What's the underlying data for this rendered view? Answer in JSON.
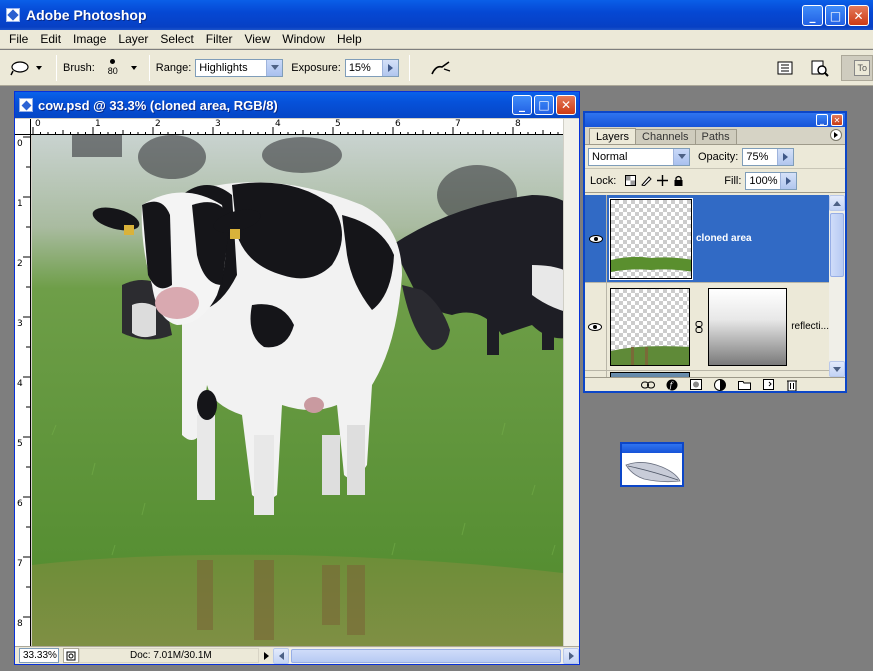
{
  "app": {
    "title": "Adobe Photoshop"
  },
  "menu": [
    "File",
    "Edit",
    "Image",
    "Layer",
    "Select",
    "Filter",
    "View",
    "Window",
    "Help"
  ],
  "options": {
    "brush_label": "Brush:",
    "brush_size": "80",
    "range_label": "Range:",
    "range_value": "Highlights",
    "exposure_label": "Exposure:",
    "exposure_value": "15%",
    "tool_icon": "dodge-tool-icon",
    "well_stub": "To"
  },
  "document": {
    "title": "cow.psd @ 33.3% (cloned area, RGB/8)",
    "zoom": "33.33%",
    "doc_info": "Doc: 7.01M/30.1M",
    "ruler_h": [
      "0",
      "1",
      "2",
      "3",
      "4",
      "5",
      "6",
      "7",
      "8"
    ],
    "ruler_v": [
      "0",
      "1",
      "2",
      "3",
      "4",
      "5",
      "6",
      "7",
      "8"
    ]
  },
  "layers_panel": {
    "tabs": [
      "Layers",
      "Channels",
      "Paths"
    ],
    "blend_mode": "Normal",
    "opacity_label": "Opacity:",
    "opacity_value": "75%",
    "lock_label": "Lock:",
    "fill_label": "Fill:",
    "fill_value": "100%",
    "layers": [
      {
        "name": "cloned area",
        "selected": true
      },
      {
        "name": "reflecti...",
        "selected": false
      }
    ]
  },
  "colors": {
    "selection": "#316ac5",
    "titlebar": "#0548d4",
    "chrome": "#ece9d8"
  }
}
